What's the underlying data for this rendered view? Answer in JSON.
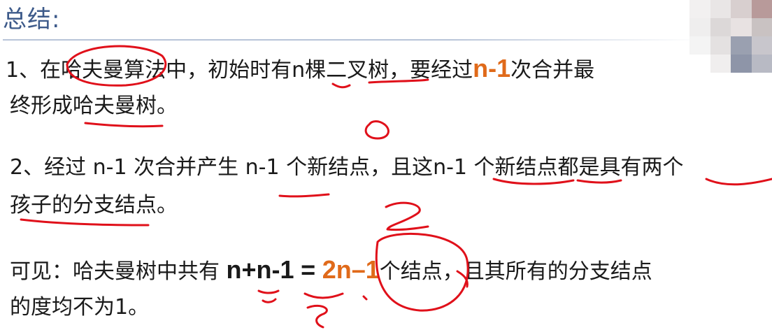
{
  "title": "总结:",
  "item1": {
    "part_a": "1、在哈夫曼算法中，初始时有n棵二叉树，要经过",
    "highlight": "n-1",
    "part_b": "次合并最",
    "line2": "终形成哈夫曼树。"
  },
  "item2": {
    "line1": "2、经过 n-1 次合并产生 n-1 个新结点，且这n-1 个新结点都是具有两个",
    "line2": "孩子的分支结点。"
  },
  "conclusion": {
    "prefix": "可见：哈夫曼树中共有",
    "expr": "n+n-1",
    "equals": "=",
    "result": "2n–1",
    "suffix": "个结点，且其所有的分支结点",
    "line2": "的度均不为1。"
  },
  "colors": {
    "title": "#3d5a8a",
    "highlight": "#e06a1a",
    "annotation_ink": "#e0101a"
  }
}
